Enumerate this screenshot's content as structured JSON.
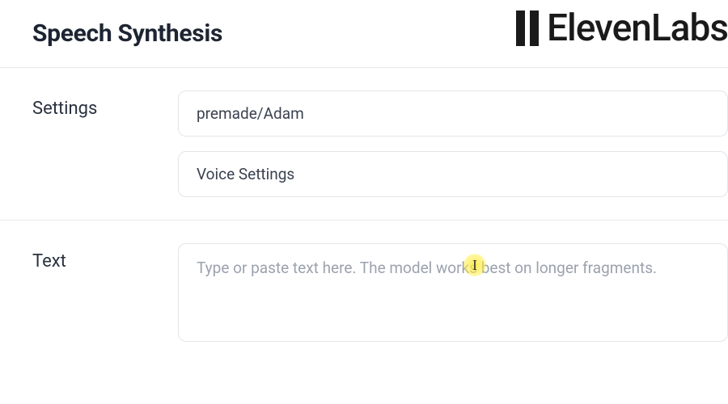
{
  "header": {
    "title": "Speech Synthesis",
    "brand": "ElevenLabs"
  },
  "settings": {
    "section_label": "Settings",
    "voice_select_value": "premade/Adam",
    "voice_settings_label": "Voice Settings"
  },
  "text": {
    "section_label": "Text",
    "placeholder": "Type or paste text here. The model works best on longer fragments.",
    "value": ""
  }
}
